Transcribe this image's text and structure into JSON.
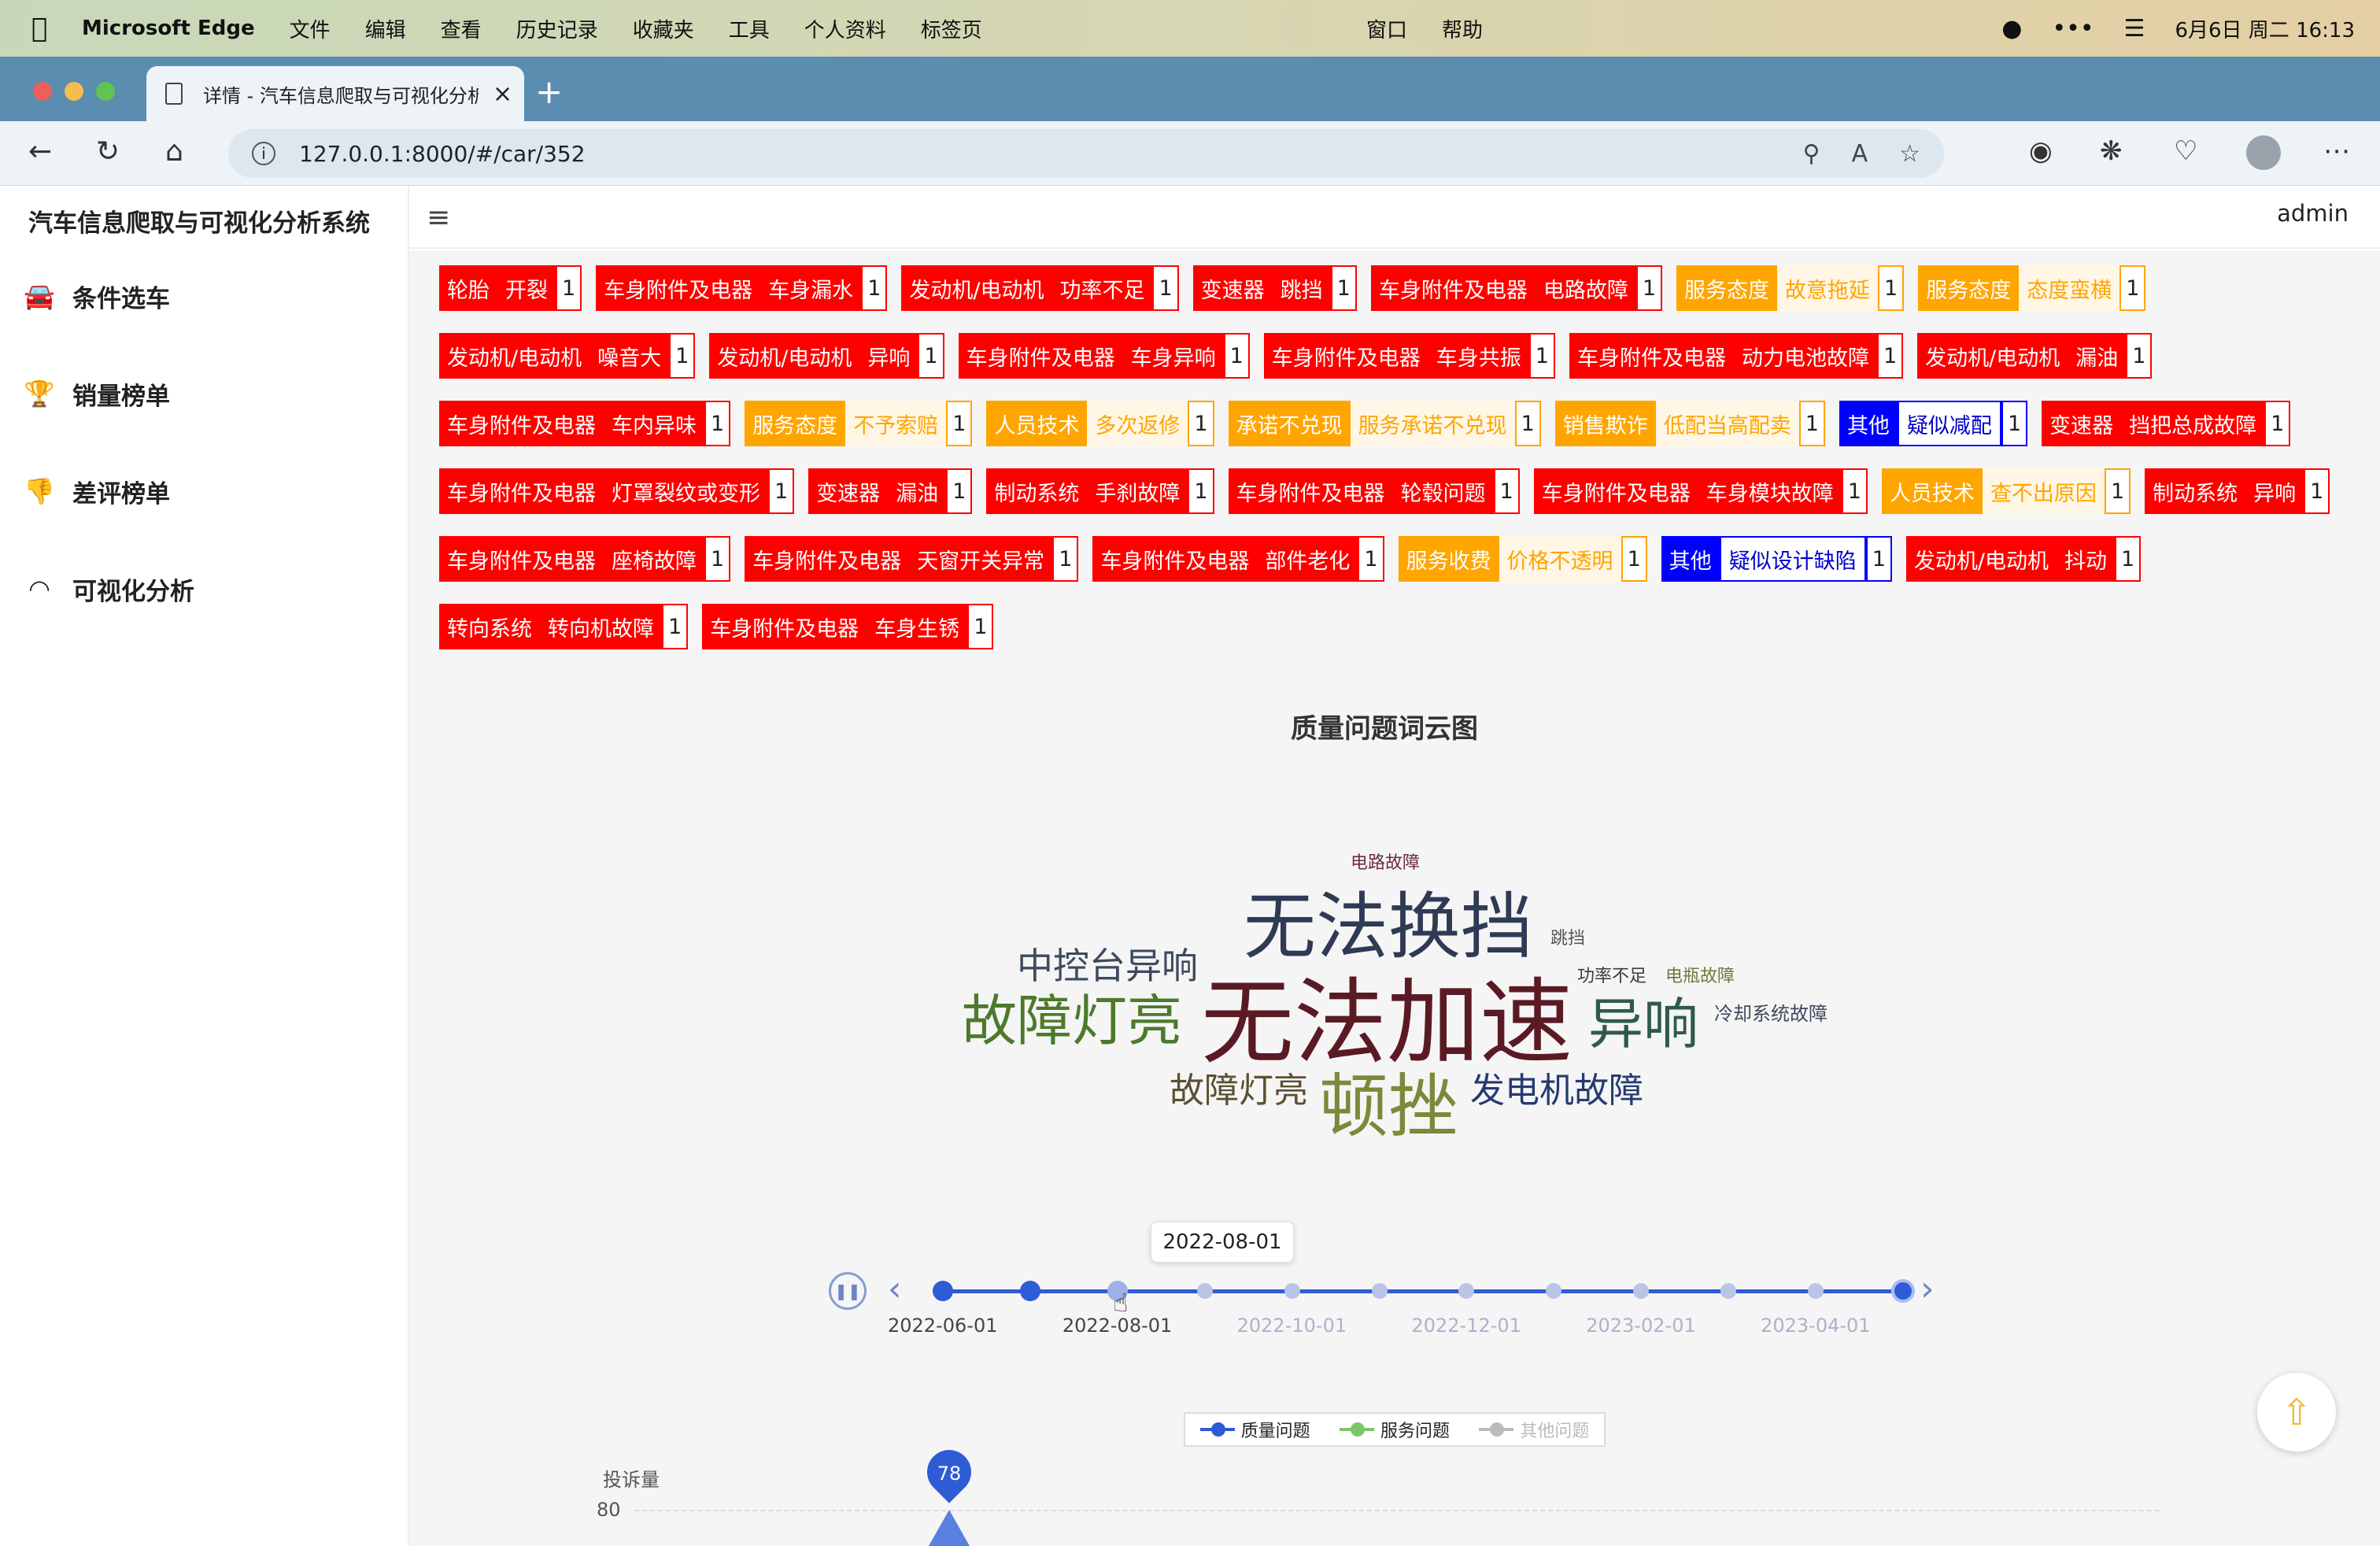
{
  "menubar": {
    "app_name": "Microsoft Edge",
    "items": [
      "文件",
      "编辑",
      "查看",
      "历史记录",
      "收藏夹",
      "工具",
      "个人资料",
      "标签页"
    ],
    "center_items": [
      "窗口",
      "帮助"
    ],
    "datetime": "6月6日 周二 16:13"
  },
  "browser": {
    "tab_title": "详情 - 汽车信息爬取与可视化分析",
    "url": "127.0.0.1:8000/#/car/352"
  },
  "app": {
    "brand": "汽车信息爬取与可视化分析系统",
    "user": "admin",
    "nav": [
      {
        "label": "条件选车",
        "icon": "car-icon"
      },
      {
        "label": "销量榜单",
        "icon": "trophy-icon"
      },
      {
        "label": "差评榜单",
        "icon": "thumbs-down-icon"
      },
      {
        "label": "可视化分析",
        "icon": "circle-icon"
      }
    ]
  },
  "tags": [
    {
      "cat": "轮胎",
      "problem": "开裂",
      "count": "1",
      "color": "red"
    },
    {
      "cat": "车身附件及电器",
      "problem": "车身漏水",
      "count": "1",
      "color": "red"
    },
    {
      "cat": "发动机/电动机",
      "problem": "功率不足",
      "count": "1",
      "color": "red"
    },
    {
      "cat": "变速器",
      "problem": "跳挡",
      "count": "1",
      "color": "red"
    },
    {
      "cat": "车身附件及电器",
      "problem": "电路故障",
      "count": "1",
      "color": "red"
    },
    {
      "cat": "服务态度",
      "problem": "故意拖延",
      "count": "1",
      "color": "orange"
    },
    {
      "cat": "服务态度",
      "problem": "态度蛮横",
      "count": "1",
      "color": "orange"
    },
    {
      "cat": "发动机/电动机",
      "problem": "噪音大",
      "count": "1",
      "color": "red"
    },
    {
      "cat": "发动机/电动机",
      "problem": "异响",
      "count": "1",
      "color": "red"
    },
    {
      "cat": "车身附件及电器",
      "problem": "车身异响",
      "count": "1",
      "color": "red"
    },
    {
      "cat": "车身附件及电器",
      "problem": "车身共振",
      "count": "1",
      "color": "red"
    },
    {
      "cat": "车身附件及电器",
      "problem": "动力电池故障",
      "count": "1",
      "color": "red"
    },
    {
      "cat": "发动机/电动机",
      "problem": "漏油",
      "count": "1",
      "color": "red"
    },
    {
      "cat": "车身附件及电器",
      "problem": "车内异味",
      "count": "1",
      "color": "red"
    },
    {
      "cat": "服务态度",
      "problem": "不予索赔",
      "count": "1",
      "color": "orange"
    },
    {
      "cat": "人员技术",
      "problem": "多次返修",
      "count": "1",
      "color": "orange"
    },
    {
      "cat": "承诺不兑现",
      "problem": "服务承诺不兑现",
      "count": "1",
      "color": "orange"
    },
    {
      "cat": "销售欺诈",
      "problem": "低配当高配卖",
      "count": "1",
      "color": "orange"
    },
    {
      "cat": "其他",
      "problem": "疑似减配",
      "count": "1",
      "color": "blue"
    },
    {
      "cat": "变速器",
      "problem": "挡把总成故障",
      "count": "1",
      "color": "red"
    },
    {
      "cat": "车身附件及电器",
      "problem": "灯罩裂纹或变形",
      "count": "1",
      "color": "red"
    },
    {
      "cat": "变速器",
      "problem": "漏油",
      "count": "1",
      "color": "red"
    },
    {
      "cat": "制动系统",
      "problem": "手刹故障",
      "count": "1",
      "color": "red"
    },
    {
      "cat": "车身附件及电器",
      "problem": "轮毂问题",
      "count": "1",
      "color": "red"
    },
    {
      "cat": "车身附件及电器",
      "problem": "车身模块故障",
      "count": "1",
      "color": "red"
    },
    {
      "cat": "人员技术",
      "problem": "查不出原因",
      "count": "1",
      "color": "orange"
    },
    {
      "cat": "制动系统",
      "problem": "异响",
      "count": "1",
      "color": "red"
    },
    {
      "cat": "车身附件及电器",
      "problem": "座椅故障",
      "count": "1",
      "color": "red"
    },
    {
      "cat": "车身附件及电器",
      "problem": "天窗开关异常",
      "count": "1",
      "color": "red"
    },
    {
      "cat": "车身附件及电器",
      "problem": "部件老化",
      "count": "1",
      "color": "red"
    },
    {
      "cat": "服务收费",
      "problem": "价格不透明",
      "count": "1",
      "color": "orange"
    },
    {
      "cat": "其他",
      "problem": "疑似设计缺陷",
      "count": "1",
      "color": "blue"
    },
    {
      "cat": "发动机/电动机",
      "problem": "抖动",
      "count": "1",
      "color": "red"
    },
    {
      "cat": "转向系统",
      "problem": "转向机故障",
      "count": "1",
      "color": "red"
    },
    {
      "cat": "车身附件及电器",
      "problem": "车身生锈",
      "count": "1",
      "color": "red"
    }
  ],
  "wordcloud": {
    "title": "质量问题词云图",
    "words": [
      "电路故障",
      "无法换挡",
      "跳挡",
      "中控台异响",
      "功率不足",
      "电瓶故障",
      "故障灯亮",
      "无法加速",
      "异响",
      "冷却系统故障",
      "故障灯亮",
      "顿挫",
      "发电机故障"
    ]
  },
  "timeline": {
    "tooltip": "2022-08-01",
    "labels": [
      "2022-06-01",
      "2022-08-01",
      "2022-10-01",
      "2022-12-01",
      "2023-02-01",
      "2023-04-01"
    ],
    "point_count": 12,
    "current_index": 2
  },
  "legend": [
    {
      "name": "质量问题",
      "color": "#2f5bd6"
    },
    {
      "name": "服务问题",
      "color": "#7ec46a"
    },
    {
      "name": "其他问题",
      "color": "#bbbbbb"
    }
  ],
  "chart": {
    "y_title": "投诉量",
    "y_tick": "80",
    "marker_value": "78"
  }
}
